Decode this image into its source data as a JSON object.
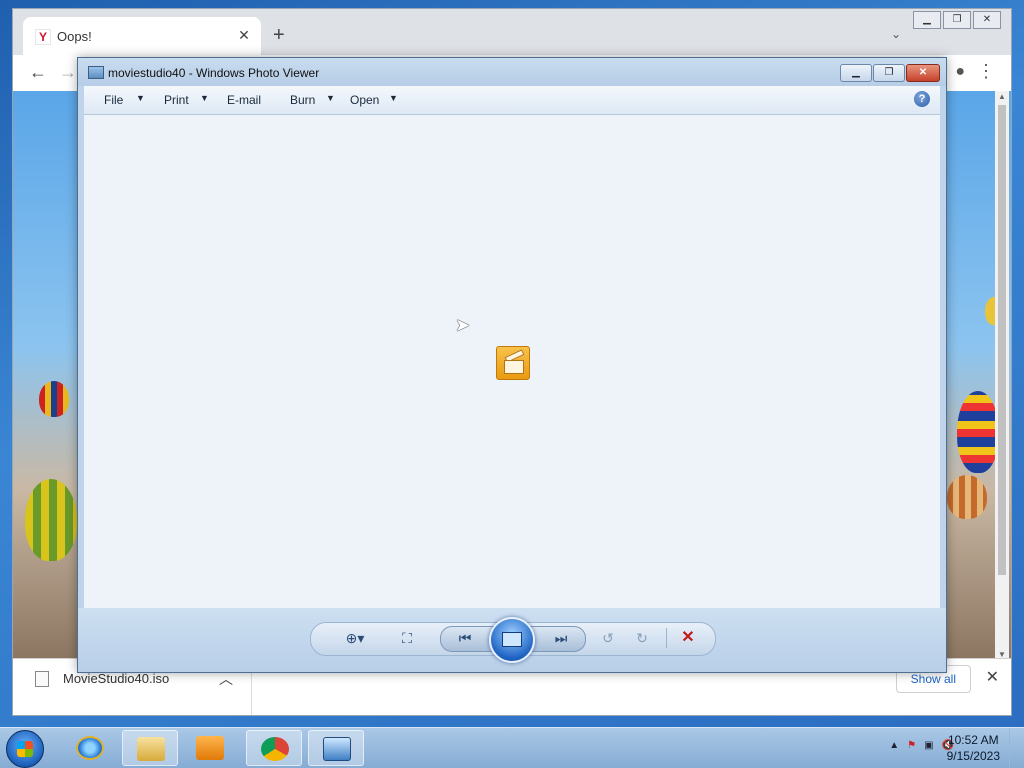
{
  "browser": {
    "tab_title": "Oops!",
    "tab_favicon": "Y",
    "newtab_symbol": "+",
    "download": {
      "filename": "MovieStudio40.iso",
      "show_all": "Show all"
    }
  },
  "photo_viewer": {
    "title": "moviestudio40 - Windows Photo Viewer",
    "menu": {
      "file": "File",
      "print": "Print",
      "email": "E-mail",
      "burn": "Burn",
      "open": "Open"
    },
    "help_glyph": "?"
  },
  "taskbar": {
    "clock_time": "10:52 AM",
    "clock_date": "9/15/2023"
  },
  "colors": {
    "accent": "#1f64c4",
    "delete_red": "#c41a1a",
    "file_icon_orange": "#ea9a12"
  },
  "icons": [
    "search-icon",
    "back-arrow-icon",
    "forward-arrow-icon",
    "account-icon",
    "kebab-menu-icon",
    "zoom-icon",
    "actual-size-icon",
    "previous-icon",
    "slideshow-icon",
    "next-icon",
    "rotate-left-icon",
    "rotate-right-icon",
    "delete-icon",
    "help-icon"
  ]
}
